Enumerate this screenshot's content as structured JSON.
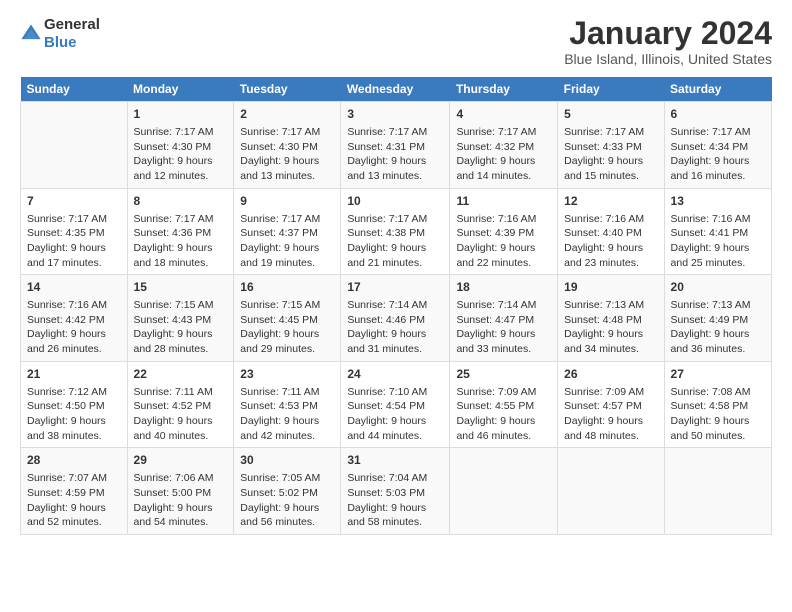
{
  "header": {
    "logo_general": "General",
    "logo_blue": "Blue",
    "title": "January 2024",
    "subtitle": "Blue Island, Illinois, United States"
  },
  "weekdays": [
    "Sunday",
    "Monday",
    "Tuesday",
    "Wednesday",
    "Thursday",
    "Friday",
    "Saturday"
  ],
  "weeks": [
    [
      {
        "day": "",
        "content": ""
      },
      {
        "day": "1",
        "content": "Sunrise: 7:17 AM\nSunset: 4:30 PM\nDaylight: 9 hours and 12 minutes."
      },
      {
        "day": "2",
        "content": "Sunrise: 7:17 AM\nSunset: 4:30 PM\nDaylight: 9 hours and 13 minutes."
      },
      {
        "day": "3",
        "content": "Sunrise: 7:17 AM\nSunset: 4:31 PM\nDaylight: 9 hours and 13 minutes."
      },
      {
        "day": "4",
        "content": "Sunrise: 7:17 AM\nSunset: 4:32 PM\nDaylight: 9 hours and 14 minutes."
      },
      {
        "day": "5",
        "content": "Sunrise: 7:17 AM\nSunset: 4:33 PM\nDaylight: 9 hours and 15 minutes."
      },
      {
        "day": "6",
        "content": "Sunrise: 7:17 AM\nSunset: 4:34 PM\nDaylight: 9 hours and 16 minutes."
      }
    ],
    [
      {
        "day": "7",
        "content": "Sunrise: 7:17 AM\nSunset: 4:35 PM\nDaylight: 9 hours and 17 minutes."
      },
      {
        "day": "8",
        "content": "Sunrise: 7:17 AM\nSunset: 4:36 PM\nDaylight: 9 hours and 18 minutes."
      },
      {
        "day": "9",
        "content": "Sunrise: 7:17 AM\nSunset: 4:37 PM\nDaylight: 9 hours and 19 minutes."
      },
      {
        "day": "10",
        "content": "Sunrise: 7:17 AM\nSunset: 4:38 PM\nDaylight: 9 hours and 21 minutes."
      },
      {
        "day": "11",
        "content": "Sunrise: 7:16 AM\nSunset: 4:39 PM\nDaylight: 9 hours and 22 minutes."
      },
      {
        "day": "12",
        "content": "Sunrise: 7:16 AM\nSunset: 4:40 PM\nDaylight: 9 hours and 23 minutes."
      },
      {
        "day": "13",
        "content": "Sunrise: 7:16 AM\nSunset: 4:41 PM\nDaylight: 9 hours and 25 minutes."
      }
    ],
    [
      {
        "day": "14",
        "content": "Sunrise: 7:16 AM\nSunset: 4:42 PM\nDaylight: 9 hours and 26 minutes."
      },
      {
        "day": "15",
        "content": "Sunrise: 7:15 AM\nSunset: 4:43 PM\nDaylight: 9 hours and 28 minutes."
      },
      {
        "day": "16",
        "content": "Sunrise: 7:15 AM\nSunset: 4:45 PM\nDaylight: 9 hours and 29 minutes."
      },
      {
        "day": "17",
        "content": "Sunrise: 7:14 AM\nSunset: 4:46 PM\nDaylight: 9 hours and 31 minutes."
      },
      {
        "day": "18",
        "content": "Sunrise: 7:14 AM\nSunset: 4:47 PM\nDaylight: 9 hours and 33 minutes."
      },
      {
        "day": "19",
        "content": "Sunrise: 7:13 AM\nSunset: 4:48 PM\nDaylight: 9 hours and 34 minutes."
      },
      {
        "day": "20",
        "content": "Sunrise: 7:13 AM\nSunset: 4:49 PM\nDaylight: 9 hours and 36 minutes."
      }
    ],
    [
      {
        "day": "21",
        "content": "Sunrise: 7:12 AM\nSunset: 4:50 PM\nDaylight: 9 hours and 38 minutes."
      },
      {
        "day": "22",
        "content": "Sunrise: 7:11 AM\nSunset: 4:52 PM\nDaylight: 9 hours and 40 minutes."
      },
      {
        "day": "23",
        "content": "Sunrise: 7:11 AM\nSunset: 4:53 PM\nDaylight: 9 hours and 42 minutes."
      },
      {
        "day": "24",
        "content": "Sunrise: 7:10 AM\nSunset: 4:54 PM\nDaylight: 9 hours and 44 minutes."
      },
      {
        "day": "25",
        "content": "Sunrise: 7:09 AM\nSunset: 4:55 PM\nDaylight: 9 hours and 46 minutes."
      },
      {
        "day": "26",
        "content": "Sunrise: 7:09 AM\nSunset: 4:57 PM\nDaylight: 9 hours and 48 minutes."
      },
      {
        "day": "27",
        "content": "Sunrise: 7:08 AM\nSunset: 4:58 PM\nDaylight: 9 hours and 50 minutes."
      }
    ],
    [
      {
        "day": "28",
        "content": "Sunrise: 7:07 AM\nSunset: 4:59 PM\nDaylight: 9 hours and 52 minutes."
      },
      {
        "day": "29",
        "content": "Sunrise: 7:06 AM\nSunset: 5:00 PM\nDaylight: 9 hours and 54 minutes."
      },
      {
        "day": "30",
        "content": "Sunrise: 7:05 AM\nSunset: 5:02 PM\nDaylight: 9 hours and 56 minutes."
      },
      {
        "day": "31",
        "content": "Sunrise: 7:04 AM\nSunset: 5:03 PM\nDaylight: 9 hours and 58 minutes."
      },
      {
        "day": "",
        "content": ""
      },
      {
        "day": "",
        "content": ""
      },
      {
        "day": "",
        "content": ""
      }
    ]
  ]
}
